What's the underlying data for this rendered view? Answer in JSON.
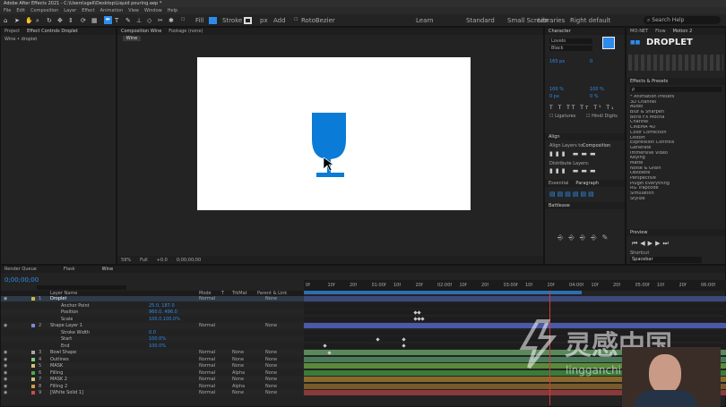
{
  "app": {
    "title": "Adobe After Effects 2021 - C:\\Users\\sgell\\Desktop\\Liquid pouring.aep *"
  },
  "menu": [
    "File",
    "Edit",
    "Composition",
    "Layer",
    "Effect",
    "Animation",
    "View",
    "Window",
    "Help"
  ],
  "toolbar": {
    "fill_label": "Fill",
    "stroke_label": "Stroke",
    "px": "px",
    "add_label": "Add",
    "rotobezier": "RotoBezier",
    "workspaces": [
      "Learn",
      "Standard",
      "Small Screen",
      "Libraries",
      "Right default"
    ],
    "search_placeholder": "Search Help"
  },
  "project_panel": {
    "tabs": [
      "Project",
      "Effect Controls Droplet"
    ],
    "subtitle": "Wine • droplet"
  },
  "comp_panel": {
    "tabs": [
      "Composition Wine",
      "Footage (none)"
    ],
    "sub_tab": "Wine",
    "zoom": "59%",
    "quality": "Full",
    "exposure": "+0.0",
    "timecode": "0;00;00;00"
  },
  "character": {
    "title": "Character",
    "font": "Lovelo",
    "style": "Black",
    "size": "165 px",
    "tracking": "0",
    "vscale": "100 %",
    "hscale": "100 %",
    "baseline": "0 px",
    "tsume": "0 %",
    "ligatures": "Ligatures",
    "hindi": "Hindi Digits"
  },
  "align": {
    "title": "Align",
    "align_to_label": "Align Layers to:",
    "align_to": "Composition",
    "distribute": "Distribute Layers:"
  },
  "paragraph": {
    "tabs": [
      "Essential",
      "Paragraph"
    ]
  },
  "battleaxe": {
    "title": "Battleaxe"
  },
  "motion": {
    "tabs": [
      "MO-NET",
      "Flow",
      "Motion 2"
    ],
    "preview_text": "DROPLET"
  },
  "effects": {
    "title": "Effects & Presets",
    "search": "ρ",
    "items": [
      "* Animation Presets",
      "3D Channel",
      "Audio",
      "Blur & Sharpen",
      "Boris FX Mocha",
      "Channel",
      "CINEMA 4D",
      "Color Correction",
      "Distort",
      "Expression Controls",
      "Generate",
      "Immersive Video",
      "Keying",
      "Matte",
      "Noise & Grain",
      "Obsolete",
      "Perspective",
      "Plugin Everything",
      "RG Trapcode",
      "Simulation",
      "Stylize"
    ]
  },
  "preview": {
    "title": "Preview",
    "shortcut_label": "Shortcut",
    "shortcut": "Spacebar"
  },
  "timeline": {
    "tabs": [
      "Render Queue",
      "Flask",
      "Wine"
    ],
    "timecode": "0;00;00;00",
    "columns": [
      "Layer Name",
      "Mode",
      "T",
      "TrkMat",
      "Parent & Link"
    ],
    "ruler": [
      "0f",
      "10f",
      "20f",
      "01:00f",
      "10f",
      "20f",
      "02:00f",
      "10f",
      "20f",
      "03:00f",
      "10f",
      "20f",
      "04:00f",
      "10f",
      "20f",
      "05:00f",
      "10f",
      "20f",
      "06:00f"
    ],
    "layers": [
      {
        "num": "1",
        "name": "Droplet",
        "mode": "Normal",
        "parent": "None",
        "indent": 0,
        "sel": true
      },
      {
        "num": "",
        "name": "Anchor Point",
        "value": "25.0, 187.0",
        "indent": 2
      },
      {
        "num": "",
        "name": "Position",
        "value": "960.0, 496.0",
        "indent": 2
      },
      {
        "num": "",
        "name": "Scale",
        "value": "100.0,100.0%",
        "indent": 2
      },
      {
        "num": "2",
        "name": "Shape Layer 1",
        "mode": "Normal",
        "parent": "None",
        "indent": 0
      },
      {
        "num": "",
        "name": "Stroke Width",
        "value": "0.0",
        "indent": 2
      },
      {
        "num": "",
        "name": "Start",
        "value": "100.0%",
        "indent": 2
      },
      {
        "num": "",
        "name": "End",
        "value": "100.0%",
        "indent": 2
      },
      {
        "num": "3",
        "name": "Bowl Shape",
        "mode": "Normal",
        "trk": "None",
        "parent": "None",
        "indent": 0
      },
      {
        "num": "4",
        "name": "Outlines",
        "mode": "Normal",
        "trk": "None",
        "parent": "None",
        "indent": 0
      },
      {
        "num": "5",
        "name": "MASK",
        "mode": "Normal",
        "trk": "None",
        "parent": "None",
        "indent": 0
      },
      {
        "num": "6",
        "name": "Filling",
        "mode": "Normal",
        "trk": "Alpha",
        "parent": "None",
        "indent": 0
      },
      {
        "num": "7",
        "name": "MASK 2",
        "mode": "Normal",
        "trk": "None",
        "parent": "None",
        "indent": 0
      },
      {
        "num": "8",
        "name": "Filling 2",
        "mode": "Normal",
        "trk": "Alpha",
        "parent": "None",
        "indent": 0
      },
      {
        "num": "9",
        "name": "[White Solid 1]",
        "mode": "Normal",
        "trk": "None",
        "parent": "None",
        "indent": 0
      }
    ]
  },
  "watermark": {
    "cn": "灵感中国",
    "url": "lingganchina.com"
  },
  "colors": {
    "accent": "#2d8ceb",
    "glass": "#0a7bd6"
  }
}
